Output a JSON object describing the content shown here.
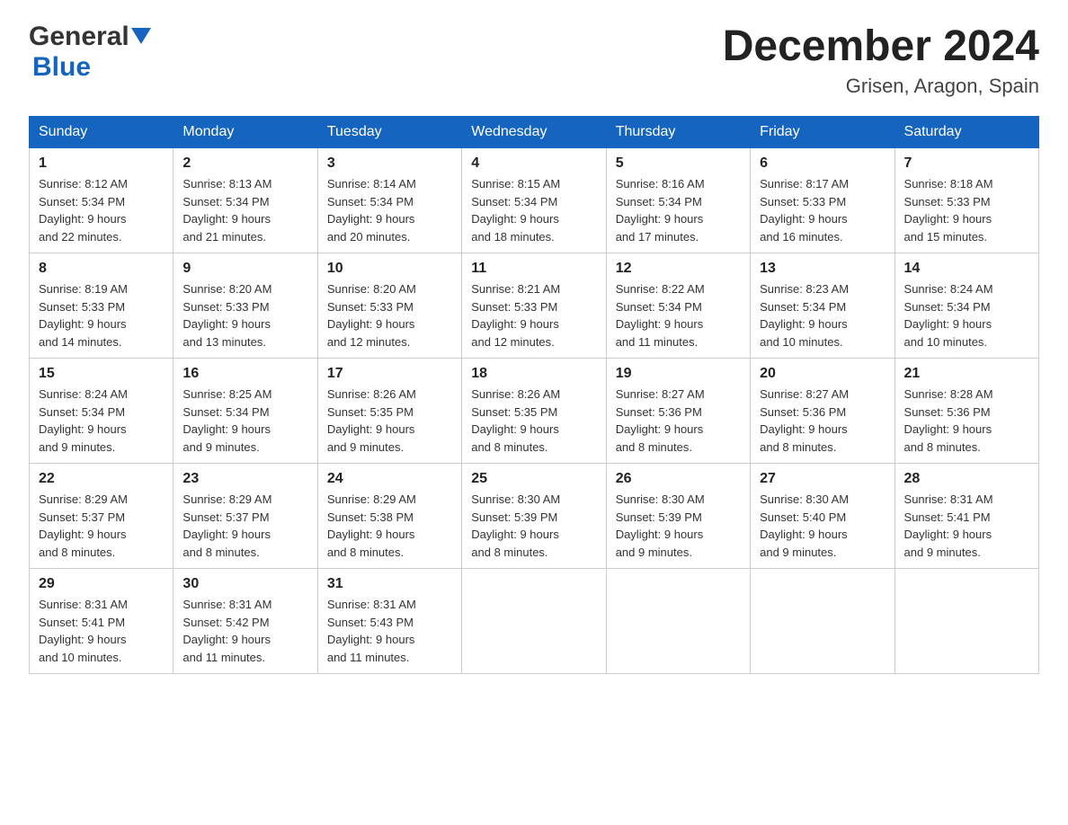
{
  "header": {
    "logo_general": "General",
    "logo_blue": "Blue",
    "month": "December 2024",
    "location": "Grisen, Aragon, Spain"
  },
  "days_of_week": [
    "Sunday",
    "Monday",
    "Tuesday",
    "Wednesday",
    "Thursday",
    "Friday",
    "Saturday"
  ],
  "weeks": [
    [
      {
        "day": "1",
        "sunrise": "8:12 AM",
        "sunset": "5:34 PM",
        "daylight": "9 hours and 22 minutes."
      },
      {
        "day": "2",
        "sunrise": "8:13 AM",
        "sunset": "5:34 PM",
        "daylight": "9 hours and 21 minutes."
      },
      {
        "day": "3",
        "sunrise": "8:14 AM",
        "sunset": "5:34 PM",
        "daylight": "9 hours and 20 minutes."
      },
      {
        "day": "4",
        "sunrise": "8:15 AM",
        "sunset": "5:34 PM",
        "daylight": "9 hours and 18 minutes."
      },
      {
        "day": "5",
        "sunrise": "8:16 AM",
        "sunset": "5:34 PM",
        "daylight": "9 hours and 17 minutes."
      },
      {
        "day": "6",
        "sunrise": "8:17 AM",
        "sunset": "5:33 PM",
        "daylight": "9 hours and 16 minutes."
      },
      {
        "day": "7",
        "sunrise": "8:18 AM",
        "sunset": "5:33 PM",
        "daylight": "9 hours and 15 minutes."
      }
    ],
    [
      {
        "day": "8",
        "sunrise": "8:19 AM",
        "sunset": "5:33 PM",
        "daylight": "9 hours and 14 minutes."
      },
      {
        "day": "9",
        "sunrise": "8:20 AM",
        "sunset": "5:33 PM",
        "daylight": "9 hours and 13 minutes."
      },
      {
        "day": "10",
        "sunrise": "8:20 AM",
        "sunset": "5:33 PM",
        "daylight": "9 hours and 12 minutes."
      },
      {
        "day": "11",
        "sunrise": "8:21 AM",
        "sunset": "5:33 PM",
        "daylight": "9 hours and 12 minutes."
      },
      {
        "day": "12",
        "sunrise": "8:22 AM",
        "sunset": "5:34 PM",
        "daylight": "9 hours and 11 minutes."
      },
      {
        "day": "13",
        "sunrise": "8:23 AM",
        "sunset": "5:34 PM",
        "daylight": "9 hours and 10 minutes."
      },
      {
        "day": "14",
        "sunrise": "8:24 AM",
        "sunset": "5:34 PM",
        "daylight": "9 hours and 10 minutes."
      }
    ],
    [
      {
        "day": "15",
        "sunrise": "8:24 AM",
        "sunset": "5:34 PM",
        "daylight": "9 hours and 9 minutes."
      },
      {
        "day": "16",
        "sunrise": "8:25 AM",
        "sunset": "5:34 PM",
        "daylight": "9 hours and 9 minutes."
      },
      {
        "day": "17",
        "sunrise": "8:26 AM",
        "sunset": "5:35 PM",
        "daylight": "9 hours and 9 minutes."
      },
      {
        "day": "18",
        "sunrise": "8:26 AM",
        "sunset": "5:35 PM",
        "daylight": "9 hours and 8 minutes."
      },
      {
        "day": "19",
        "sunrise": "8:27 AM",
        "sunset": "5:36 PM",
        "daylight": "9 hours and 8 minutes."
      },
      {
        "day": "20",
        "sunrise": "8:27 AM",
        "sunset": "5:36 PM",
        "daylight": "9 hours and 8 minutes."
      },
      {
        "day": "21",
        "sunrise": "8:28 AM",
        "sunset": "5:36 PM",
        "daylight": "9 hours and 8 minutes."
      }
    ],
    [
      {
        "day": "22",
        "sunrise": "8:29 AM",
        "sunset": "5:37 PM",
        "daylight": "9 hours and 8 minutes."
      },
      {
        "day": "23",
        "sunrise": "8:29 AM",
        "sunset": "5:37 PM",
        "daylight": "9 hours and 8 minutes."
      },
      {
        "day": "24",
        "sunrise": "8:29 AM",
        "sunset": "5:38 PM",
        "daylight": "9 hours and 8 minutes."
      },
      {
        "day": "25",
        "sunrise": "8:30 AM",
        "sunset": "5:39 PM",
        "daylight": "9 hours and 8 minutes."
      },
      {
        "day": "26",
        "sunrise": "8:30 AM",
        "sunset": "5:39 PM",
        "daylight": "9 hours and 9 minutes."
      },
      {
        "day": "27",
        "sunrise": "8:30 AM",
        "sunset": "5:40 PM",
        "daylight": "9 hours and 9 minutes."
      },
      {
        "day": "28",
        "sunrise": "8:31 AM",
        "sunset": "5:41 PM",
        "daylight": "9 hours and 9 minutes."
      }
    ],
    [
      {
        "day": "29",
        "sunrise": "8:31 AM",
        "sunset": "5:41 PM",
        "daylight": "9 hours and 10 minutes."
      },
      {
        "day": "30",
        "sunrise": "8:31 AM",
        "sunset": "5:42 PM",
        "daylight": "9 hours and 11 minutes."
      },
      {
        "day": "31",
        "sunrise": "8:31 AM",
        "sunset": "5:43 PM",
        "daylight": "9 hours and 11 minutes."
      },
      null,
      null,
      null,
      null
    ]
  ]
}
